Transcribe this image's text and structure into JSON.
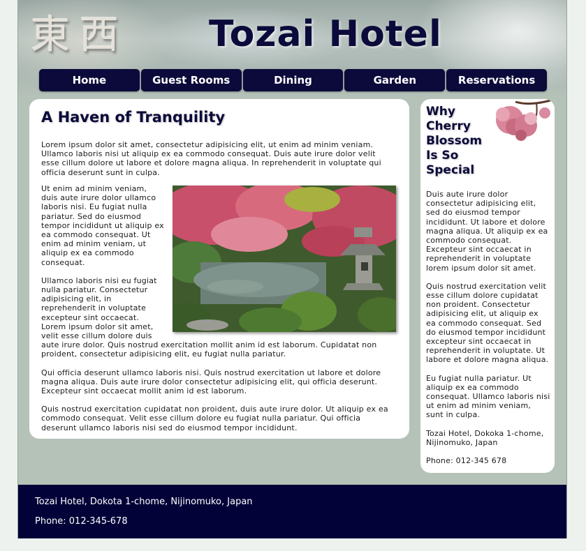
{
  "header": {
    "logo_text": "東西",
    "site_title": "Tozai Hotel"
  },
  "nav": {
    "items": [
      "Home",
      "Guest Rooms",
      "Dining",
      "Garden",
      "Reservations"
    ]
  },
  "main": {
    "heading": "A Haven of Tranquility",
    "paragraphs": [
      "Lorem ipsum dolor sit amet, consectetur adipisicing elit, ut enim ad minim veniam. Ullamco laboris nisi ut aliquip ex ea commodo consequat. Duis aute irure dolor velit esse cillum dolore ut labore et dolore magna aliqua. In reprehenderit in voluptate qui officia deserunt sunt in culpa.",
      "Ut enim ad minim veniam, duis aute irure dolor ullamco laboris nisi. Eu fugiat nulla pariatur. Sed do eiusmod tempor incididunt ut aliquip ex ea commodo consequat. Ut enim ad minim veniam, ut aliquip ex ea commodo consequat.",
      "Ullamco laboris nisi eu fugiat nulla pariatur. Consectetur adipisicing elit, in reprehenderit in voluptate excepteur sint occaecat. Lorem ipsum dolor sit amet, velit esse cillum dolore duis aute irure dolor. Quis nostrud exercitation mollit anim id est laborum. Cupidatat non proident, consectetur adipisicing elit, eu fugiat nulla pariatur.",
      "Qui officia deserunt ullamco laboris nisi. Quis nostrud exercitation ut labore et dolore magna aliqua. Duis aute irure dolor consectetur adipisicing elit, qui officia deserunt. Excepteur sint occaecat mollit anim id est laborum.",
      "Quis nostrud exercitation cupidatat non proident, duis aute irure dolor. Ut aliquip ex ea commodo consequat. Velit esse cillum dolore eu fugiat nulla pariatur. Qui officia deserunt ullamco laboris nisi sed do eiusmod tempor incididunt."
    ]
  },
  "sidebar": {
    "heading": "Why Cherry Blossom Is So Special",
    "paragraphs": [
      "Duis aute irure dolor consectetur adipisicing elit, sed do eiusmod tempor incididunt. Ut labore et dolore magna aliqua. Ut aliquip ex ea commodo consequat. Excepteur sint occaecat in reprehenderit in voluptate lorem ipsum dolor sit amet.",
      "Quis nostrud exercitation velit esse cillum dolore cupidatat non proident. Consectetur adipisicing elit, ut aliquip ex ea commodo consequat. Sed do eiusmod tempor incididunt excepteur sint occaecat in reprehenderit in voluptate. Ut labore et dolore magna aliqua.",
      "Eu fugiat nulla pariatur. Ut aliquip ex ea commodo consequat. Ullamco laboris nisi ut enim ad minim veniam, sunt in culpa.",
      "Tozai Hotel, Dokoka 1-chome, Nijinomuko, Japan",
      "Phone: 012-345 678"
    ]
  },
  "footer": {
    "address": "Tozai Hotel, Dokota 1-chome, Nijinomuko, Japan",
    "phone": "Phone: 012-345-678"
  }
}
